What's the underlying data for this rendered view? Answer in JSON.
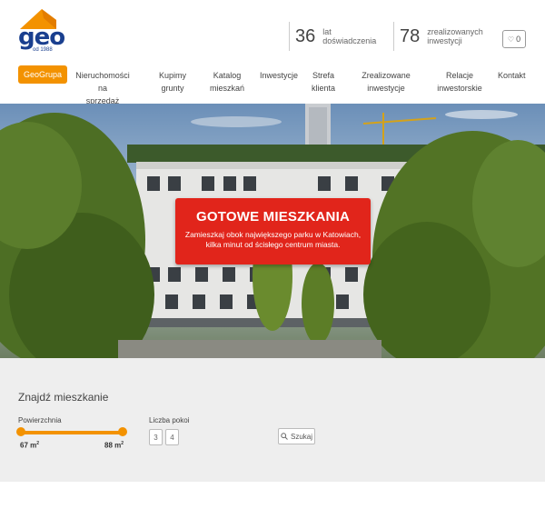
{
  "brand": {
    "name": "geo",
    "since": "od 1988",
    "colors": {
      "orange": "#f39200",
      "blue": "#1a3f8f",
      "red": "#e1251b"
    }
  },
  "stats": [
    {
      "value": "36",
      "label_line1": "lat",
      "label_line2": "doświadczenia"
    },
    {
      "value": "78",
      "label_line1": "zrealizowanych",
      "label_line2": "inwestycji"
    }
  ],
  "favorites": {
    "icon": "heart-icon",
    "count": "0"
  },
  "nav": {
    "items": [
      {
        "line1": "GeoGrupa",
        "line2": ""
      },
      {
        "line1": "Nieruchomości na",
        "line2": "sprzedaż"
      },
      {
        "line1": "Kupimy",
        "line2": "grunty"
      },
      {
        "line1": "Katalog",
        "line2": "mieszkań"
      },
      {
        "line1": "Inwestycje",
        "line2": ""
      },
      {
        "line1": "Strefa",
        "line2": "klienta"
      },
      {
        "line1": "Zrealizowane",
        "line2": "inwestycje"
      },
      {
        "line1": "Relacje",
        "line2": "inwestorskie"
      },
      {
        "line1": "Kontakt",
        "line2": ""
      }
    ]
  },
  "hero": {
    "title": "GOTOWE MIESZKANIA",
    "subtitle_line1": "Zamieszkaj obok największego parku w Katowiach,",
    "subtitle_line2": "kilka minut od ścisłego centrum miasta."
  },
  "search": {
    "title": "Znajdź mieszkanie",
    "area": {
      "label": "Powierzchnia",
      "min": "67 m",
      "max": "88 m",
      "unit_sup": "2"
    },
    "rooms": {
      "label": "Liczba pokoi",
      "options": [
        "3",
        "4"
      ]
    },
    "button": {
      "label": "Szukaj",
      "icon": "search-icon"
    }
  }
}
